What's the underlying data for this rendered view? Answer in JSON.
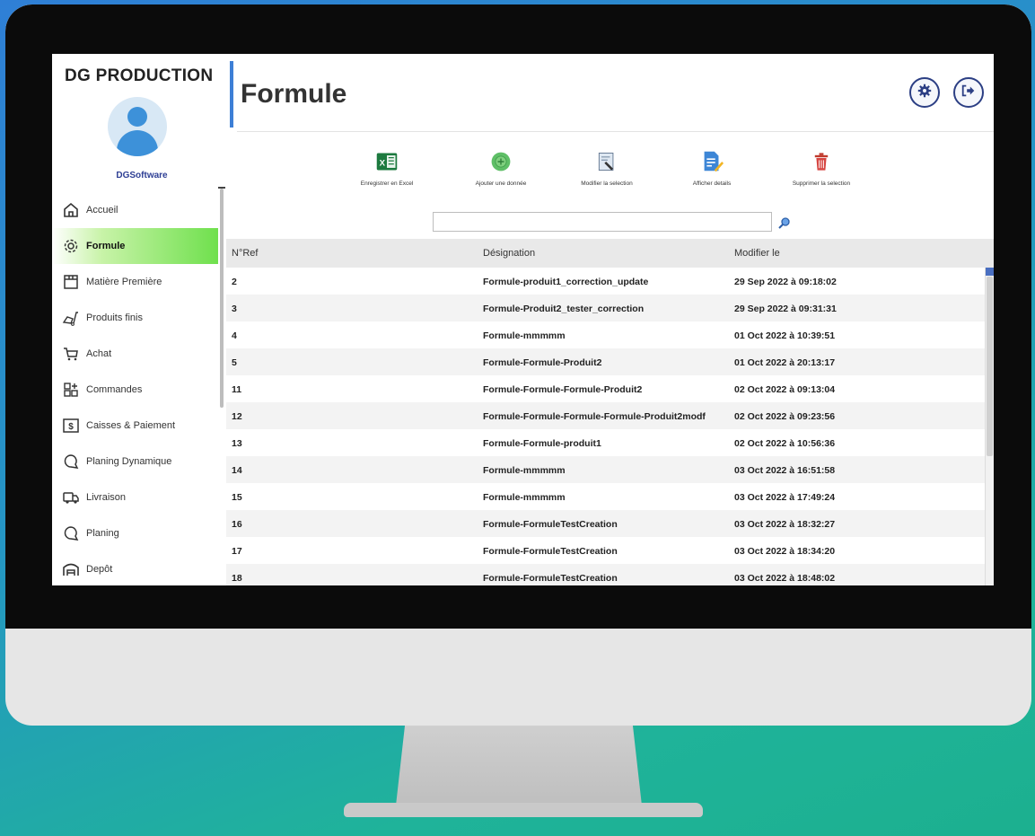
{
  "app": {
    "brand": "DG PRODUCTION",
    "username": "DGSoftware"
  },
  "page": {
    "title": "Formule"
  },
  "sidebar": {
    "items": [
      {
        "label": "Accueil",
        "icon": "home-icon"
      },
      {
        "label": "Formule",
        "icon": "gear-icon",
        "active": true
      },
      {
        "label": "Matière Première",
        "icon": "box-icon"
      },
      {
        "label": "Produits finis",
        "icon": "cart-loading-icon"
      },
      {
        "label": "Achat",
        "icon": "cart-icon"
      },
      {
        "label": "Commandes",
        "icon": "grid-add-icon"
      },
      {
        "label": "Caisses & Paiement",
        "icon": "dollar-icon"
      },
      {
        "label": "Planing Dynamique",
        "icon": "chat-icon"
      },
      {
        "label": "Livraison",
        "icon": "truck-icon"
      },
      {
        "label": "Planing",
        "icon": "chat-icon"
      },
      {
        "label": "Depôt",
        "icon": "warehouse-icon"
      }
    ]
  },
  "toolbar": {
    "excel": "Enregistrer en Excel",
    "add": "Ajouter une donnée",
    "edit": "Modifier la selection",
    "details": "Afficher details",
    "delete": "Supprimer la selection"
  },
  "search": {
    "value": ""
  },
  "table": {
    "headers": [
      "N°Ref",
      "Désignation",
      "Modifier le"
    ],
    "rows": [
      [
        "2",
        "Formule-produit1_correction_update",
        "29 Sep 2022 à 09:18:02"
      ],
      [
        "3",
        "Formule-Produit2_tester_correction",
        "29 Sep 2022 à 09:31:31"
      ],
      [
        "4",
        "Formule-mmmmm",
        "01 Oct 2022 à 10:39:51"
      ],
      [
        "5",
        "Formule-Formule-Produit2",
        "01 Oct 2022 à 20:13:17"
      ],
      [
        "11",
        "Formule-Formule-Formule-Produit2",
        "02 Oct 2022 à 09:13:04"
      ],
      [
        "12",
        "Formule-Formule-Formule-Formule-Produit2modf",
        "02 Oct 2022 à 09:23:56"
      ],
      [
        "13",
        "Formule-Formule-produit1",
        "02 Oct 2022 à 10:56:36"
      ],
      [
        "14",
        "Formule-mmmmm",
        "03 Oct 2022 à 16:51:58"
      ],
      [
        "15",
        "Formule-mmmmm",
        "03 Oct 2022 à 17:49:24"
      ],
      [
        "16",
        "Formule-FormuleTestCreation",
        "03 Oct 2022 à 18:32:27"
      ],
      [
        "17",
        "Formule-FormuleTestCreation",
        "03 Oct 2022 à 18:34:20"
      ],
      [
        "18",
        "Formule-FormuleTestCreation",
        "03 Oct 2022 à 18:48:02"
      ]
    ]
  },
  "colors": {
    "accent": "#3d7fd6",
    "active_nav": "#6fe04d",
    "navy": "#2c3f84"
  }
}
